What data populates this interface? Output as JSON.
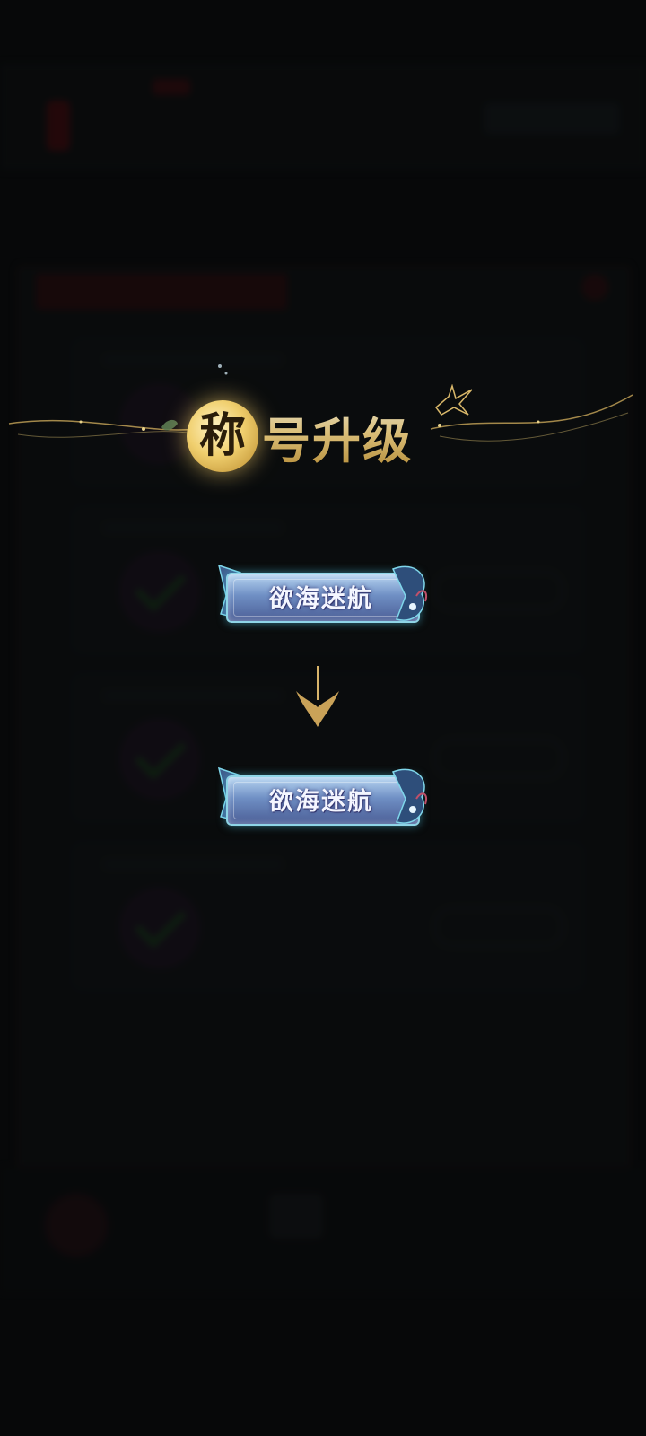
{
  "popup": {
    "title_first_char": "称",
    "title_rest": "号升级"
  },
  "titles": {
    "before": "欲海迷航",
    "after": "欲海迷航"
  },
  "icons": {
    "moon": "moon-emblem-icon",
    "arrow": "down-arrow-icon",
    "bird": "swallow-bird-icon",
    "leaf": "leaf-icon"
  },
  "colors": {
    "gold": "#f0cf6e",
    "plaque_blue": "#6f8fc4",
    "glow_cyan": "#8ed4e6",
    "background": "#0b0d0e"
  }
}
